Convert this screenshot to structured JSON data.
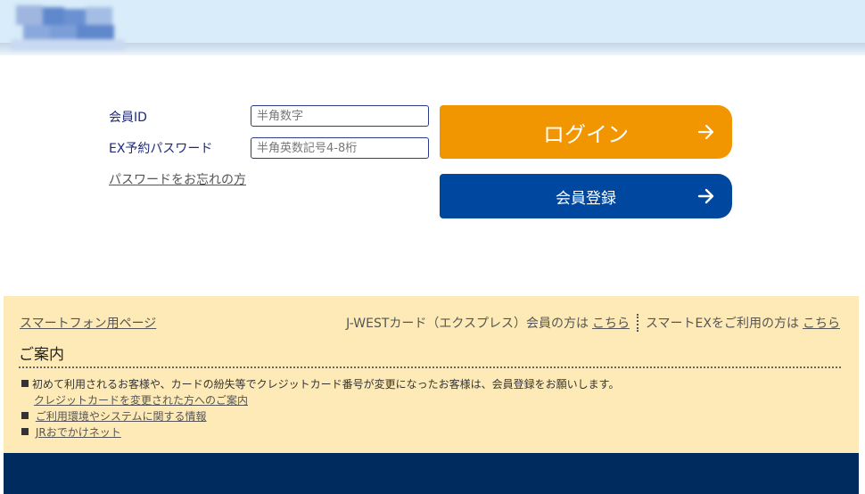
{
  "header": {
    "logo_icon": "blurred-logo"
  },
  "login": {
    "member_id_label": "会員ID",
    "member_id_placeholder": "半角数字",
    "member_id_value": "",
    "password_label": "EX予約パスワード",
    "password_placeholder": "半角英数記号4-8桁",
    "password_value": "",
    "forgot_password": "パスワードをお忘れの方",
    "login_button": "ログイン",
    "register_button": "会員登録",
    "arrow_icon": "arrow-right-icon"
  },
  "info": {
    "smartphone_link": "スマートフォン用ページ",
    "jwest_text": "J-WESTカード（エクスプレス）会員の方は",
    "jwest_link": "こちら",
    "smartex_text": "スマートEXをご利用の方は",
    "smartex_link": "こちら",
    "heading": "ご案内",
    "items": [
      {
        "text": "初めて利用されるお客様や、カードの紛失等でクレジットカード番号が変更になったお客様は、会員登録をお願いします。",
        "sub_link": "クレジットカードを変更された方へのご案内"
      },
      {
        "link": "ご利用環境やシステムに関する情報"
      },
      {
        "link": "JRおでかけネット"
      }
    ]
  },
  "colors": {
    "header_bg": "#d8ecf9",
    "login_button": "#f19500",
    "register_button": "#0047a0",
    "info_bg": "#feeab7",
    "footer_bg": "#002b5e",
    "label_text": "#1f2a7a"
  }
}
